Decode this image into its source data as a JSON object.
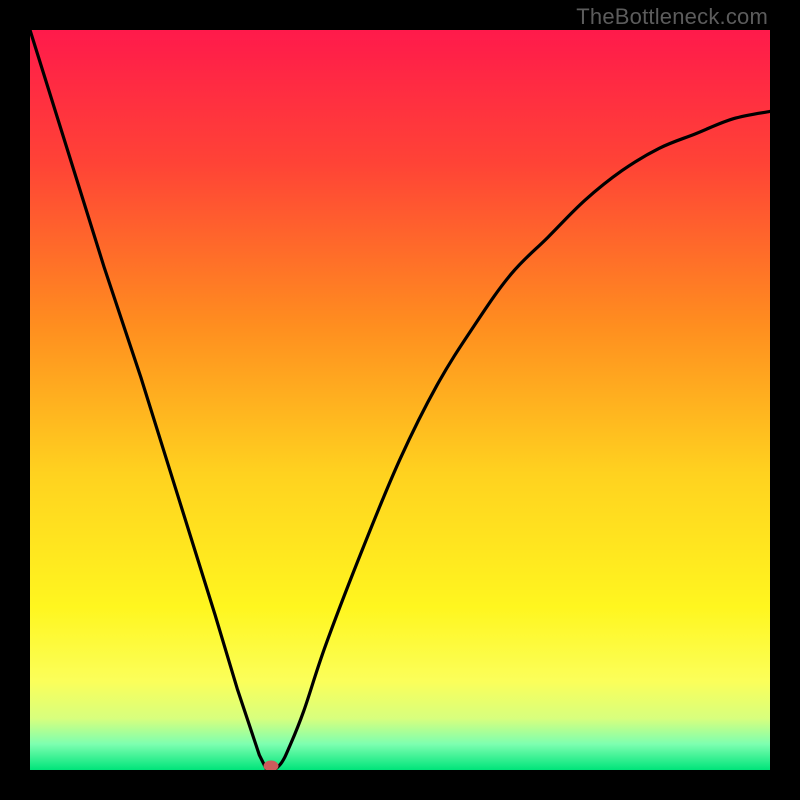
{
  "watermark": "TheBottleneck.com",
  "chart_data": {
    "type": "line",
    "title": "",
    "xlabel": "",
    "ylabel": "",
    "xlim": [
      0,
      100
    ],
    "ylim": [
      0,
      100
    ],
    "gradient_stops": [
      {
        "offset": 0.0,
        "color": "#ff1a4b"
      },
      {
        "offset": 0.18,
        "color": "#ff4336"
      },
      {
        "offset": 0.4,
        "color": "#ff8e1f"
      },
      {
        "offset": 0.6,
        "color": "#ffd21f"
      },
      {
        "offset": 0.78,
        "color": "#fff61f"
      },
      {
        "offset": 0.88,
        "color": "#fbff5a"
      },
      {
        "offset": 0.93,
        "color": "#d8ff7d"
      },
      {
        "offset": 0.965,
        "color": "#7dffb0"
      },
      {
        "offset": 1.0,
        "color": "#00e47a"
      }
    ],
    "series": [
      {
        "name": "bottleneck-curve",
        "x": [
          0,
          5,
          10,
          15,
          20,
          25,
          28,
          30,
          31,
          32,
          33,
          34,
          35,
          37,
          40,
          45,
          50,
          55,
          60,
          65,
          70,
          75,
          80,
          85,
          90,
          95,
          100
        ],
        "y": [
          100,
          84,
          68,
          53,
          37,
          21,
          11,
          5,
          2,
          0,
          0,
          1,
          3,
          8,
          17,
          30,
          42,
          52,
          60,
          67,
          72,
          77,
          81,
          84,
          86,
          88,
          89
        ]
      }
    ],
    "marker": {
      "x": 32.5,
      "y": 0.5,
      "color": "#cd5c5c"
    }
  }
}
